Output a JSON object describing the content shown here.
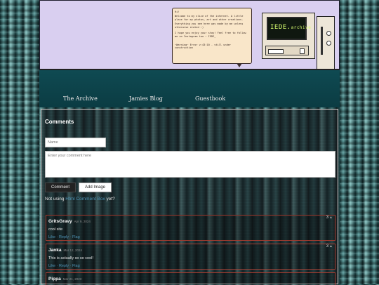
{
  "header": {
    "speech_lines": [
      "Hi!",
      "Welcome to my slice of the internet. A little place for my photos, art and other creations.",
      "Everything you see here was made by me unless otherwise stated :)",
      "I hope you enjoy your stay! Feel free to follow me on Instagram too ~ IEDE_",
      "~Warning~ Error v:43:10 - still under construction"
    ],
    "screen_title": "IEDE.",
    "screen_suffix": "archive"
  },
  "nav": {
    "items": [
      "The Archive",
      "Jamies Blog",
      "Guestbook"
    ]
  },
  "comments_section": {
    "title": "Comments",
    "name_placeholder": "Name",
    "comment_placeholder": "Enter your comment here",
    "comment_button": "Comment",
    "image_button": "Add Image",
    "not_using_prefix": "Not using ",
    "not_using_link": "Html Comment Box",
    "not_using_suffix": " yet?",
    "action_like": "Like",
    "action_reply": "Reply",
    "action_flag": "Flag",
    "action_sep": " · ",
    "items": [
      {
        "author": "GritsGravy",
        "date": "Apr 9, 2024",
        "text": "cool site",
        "votes": "3"
      },
      {
        "author": "Janka",
        "date": "Mar 12, 2024",
        "text": "This is actually so so cool!",
        "votes": "3"
      },
      {
        "author": "Pippa",
        "date": "Mar 21, 2023",
        "text": "",
        "votes": ""
      }
    ]
  },
  "colors": {
    "header_bg": "#d9cff0",
    "nav_bg": "#0b3c43",
    "comment_border": "#a33b2f",
    "link": "#4e93b5"
  }
}
